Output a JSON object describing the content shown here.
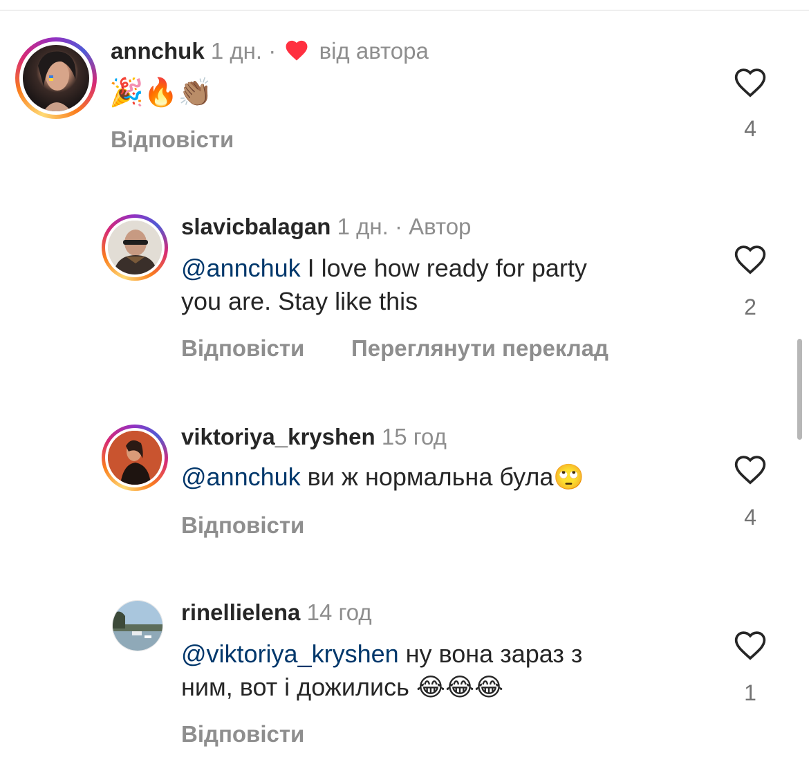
{
  "comments": [
    {
      "username": "annchuk",
      "time": "1 дн.",
      "separator": "·",
      "liked_by_author_label": "від автора",
      "body_emoji": "🎉🔥👏🏽",
      "reply_label": "Відповісти",
      "likes": "4"
    },
    {
      "username": "slavicbalagan",
      "time": "1 дн.",
      "separator": "·",
      "author_label": "Автор",
      "mention": "@annchuk",
      "body_line1": " I love how ready for party",
      "body_line2": "you are. Stay like this",
      "reply_label": "Відповісти",
      "translate_label": "Переглянути переклад",
      "likes": "2"
    },
    {
      "username": "viktoriya_kryshen",
      "time": "15 год",
      "mention": "@annchuk",
      "body_line1": " ви ж нормальна була",
      "body_emoji": "🙄",
      "reply_label": "Відповісти",
      "likes": "4"
    },
    {
      "username": "rinellielena",
      "time": "14 год",
      "mention": "@viktoriya_kryshen",
      "body_line1": " ну вона зараз з",
      "body_line2": "ним, вот і дожились ",
      "body_emoji": "😂😂😂",
      "reply_label": "Відповісти",
      "likes": "1"
    }
  ],
  "colors": {
    "text": "#262626",
    "secondary": "#8e8e8e",
    "mention": "#00376b",
    "heart_red": "#ff3040"
  },
  "icons": {
    "like": "heart-outline-icon",
    "author_like": "heart-filled-icon"
  }
}
